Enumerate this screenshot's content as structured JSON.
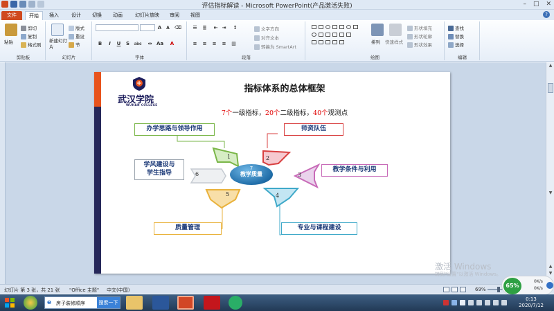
{
  "window": {
    "title": "评估指标解读 - Microsoft PowerPoint(产品激活失败)",
    "controls": [
      "–",
      "□",
      "✕"
    ]
  },
  "ribbon_tabs": [
    "文件",
    "开始",
    "插入",
    "设计",
    "切换",
    "动画",
    "幻灯片放映",
    "审阅",
    "视图"
  ],
  "ribbon": {
    "clipboard": {
      "paste": "粘贴",
      "cut": "剪切",
      "copy": "复制",
      "format_painter": "格式刷",
      "label": "剪贴板"
    },
    "slides": {
      "new_slide": "新建幻灯片",
      "layout": "版式",
      "reset": "重设",
      "section": "节",
      "label": "幻灯片"
    },
    "font": {
      "label": "字体",
      "grow": "A",
      "shrink": "A",
      "bold": "B",
      "italic": "I",
      "underline": "U",
      "strike": "S",
      "abc": "abc"
    },
    "paragraph": {
      "text_direction": "文字方向",
      "align_text": "对齐文本",
      "smartart": "转换为 SmartArt",
      "label": "段落"
    },
    "drawing": {
      "arrange": "排列",
      "quick_styles": "快速样式",
      "shape_fill": "形状填充",
      "shape_outline": "形状轮廓",
      "shape_effects": "形状效果",
      "label": "绘图"
    },
    "editing": {
      "find": "查找",
      "replace": "替换",
      "select": "选择",
      "label": "编辑"
    }
  },
  "slide": {
    "logo_cn": "武汉学院",
    "logo_en": "WUHAN COLLEGE",
    "title": "指标体系的总体框架",
    "subtitle_parts": [
      "7个",
      "一级指标，",
      "20个",
      "二级指标，",
      "40个",
      "观测点"
    ],
    "center": {
      "number": "7",
      "label": "教学质量"
    },
    "boxes": {
      "b1": "办学思路与领导作用",
      "b2": "师资队伍",
      "b3": "教学条件与利用",
      "b4": "专业与课程建设",
      "b5": "质量管理",
      "b6_line1": "学风建设与",
      "b6_line2": "学生指导"
    },
    "arrow_numbers": [
      "1",
      "2",
      "3",
      "4",
      "5",
      "6"
    ]
  },
  "watermark": {
    "line1": "激活 Windows",
    "line2": "转到\"设置\"以激活 Windows。"
  },
  "statusbar": {
    "slide_info": "幻灯片 第 3 张，共 21 张",
    "theme": "\"Office 主题\"",
    "language": "中文(中国)",
    "zoom": "69%"
  },
  "net_widget": {
    "percent": "65%",
    "up": "0K/s",
    "down": "0K/s"
  },
  "taskbar": {
    "search_text": "房子装修顺序",
    "search_button": "搜索一下",
    "time": "0:13",
    "date": "2020/7/12"
  },
  "colors": {
    "accent_orange": "#e8531c",
    "navy": "#26285a",
    "file_tab": "#d04a1f",
    "box_green": "#7ab648",
    "box_red": "#d94040",
    "box_pink": "#c86bb8",
    "box_cyan": "#3fa9c9",
    "box_gold": "#e9b23c",
    "box_gray": "#9aa3ad"
  }
}
